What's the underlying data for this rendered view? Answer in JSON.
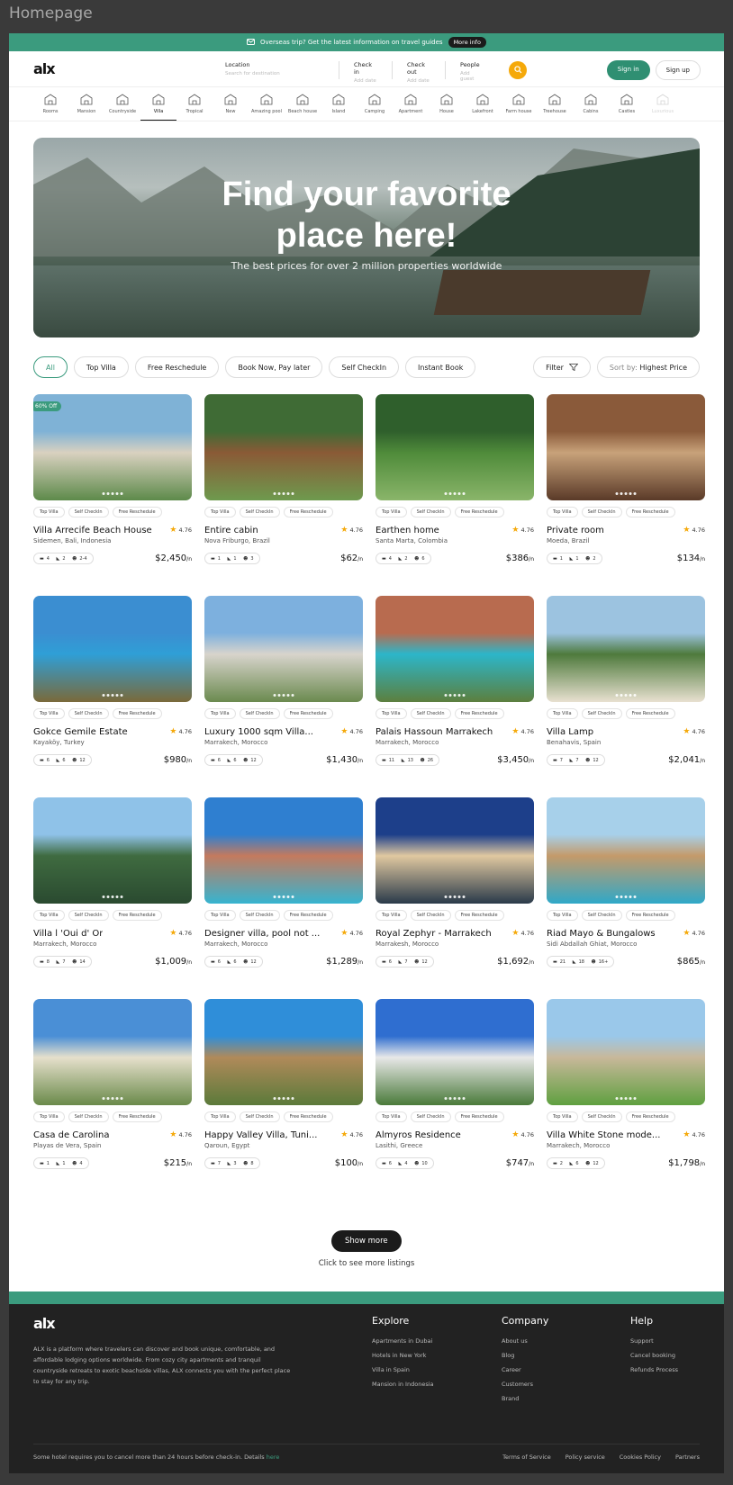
{
  "frame_title": "Homepage",
  "promo": {
    "text": "Overseas trip? Get the latest information on travel guides",
    "button": "More info"
  },
  "brand": "alx",
  "search": {
    "location": {
      "label": "Location",
      "placeholder": "Search for destination"
    },
    "checkin": {
      "label": "Check in",
      "placeholder": "Add date"
    },
    "checkout": {
      "label": "Check out",
      "placeholder": "Add date"
    },
    "people": {
      "label": "People",
      "placeholder": "Add guest"
    }
  },
  "auth": {
    "signin": "Sign in",
    "signup": "Sign up"
  },
  "categories": [
    "Rooms",
    "Mansion",
    "Countryside",
    "Villa",
    "Tropical",
    "New",
    "Amazing pool",
    "Beach house",
    "Island",
    "Camping",
    "Apartment",
    "House",
    "Lakefront",
    "Farm house",
    "Treehouse",
    "Cabins",
    "Castles",
    "Luxurious"
  ],
  "active_category": "Villa",
  "hero": {
    "title_line1": "Find your favorite",
    "title_line2": "place here!",
    "subtitle": "The best prices for over 2 million properties worldwide"
  },
  "filters": [
    "All",
    "Top Villa",
    "Free Reschedule",
    "Book Now, Pay later",
    "Self CheckIn",
    "Instant Book"
  ],
  "filter_button": "Filter",
  "sort": {
    "label": "Sort by:",
    "value": "Highest Price"
  },
  "tag_labels": [
    "Top Villa",
    "Self CheckIn",
    "Free Reschedule"
  ],
  "listings": [
    {
      "name": "Villa Arrecife Beach House",
      "location": "Sidemen, Bali, Indonesia",
      "rating": "4.76",
      "beds": "4",
      "baths": "2",
      "guests": "2-4",
      "price": "$2,450",
      "badge": "60% Off"
    },
    {
      "name": "Entire cabin",
      "location": "Nova Friburgo, Brazil",
      "rating": "4.76",
      "beds": "1",
      "baths": "1",
      "guests": "3",
      "price": "$62",
      "badge": ""
    },
    {
      "name": "Earthen home",
      "location": "Santa Marta, Colombia",
      "rating": "4.76",
      "beds": "4",
      "baths": "2",
      "guests": "6",
      "price": "$386",
      "badge": ""
    },
    {
      "name": "Private room",
      "location": "Moeda, Brazil",
      "rating": "4.76",
      "beds": "1",
      "baths": "1",
      "guests": "2",
      "price": "$134",
      "badge": ""
    },
    {
      "name": "Gokce Gemile Estate",
      "location": "Kayaköy, Turkey",
      "rating": "4.76",
      "beds": "6",
      "baths": "6",
      "guests": "12",
      "price": "$980",
      "badge": ""
    },
    {
      "name": "Luxury 1000 sqm Villa...",
      "location": "Marrakech, Morocco",
      "rating": "4.76",
      "beds": "6",
      "baths": "6",
      "guests": "12",
      "price": "$1,430",
      "badge": ""
    },
    {
      "name": "Palais Hassoun Marrakech",
      "location": "Marrakech, Morocco",
      "rating": "4.76",
      "beds": "11",
      "baths": "13",
      "guests": "26",
      "price": "$3,450",
      "badge": ""
    },
    {
      "name": "Villa Lamp",
      "location": "Benahavis, Spain",
      "rating": "4.76",
      "beds": "7",
      "baths": "7",
      "guests": "12",
      "price": "$2,041",
      "badge": ""
    },
    {
      "name": "Villa l 'Oui d' Or",
      "location": "Marrakech, Morocco",
      "rating": "4.76",
      "beds": "8",
      "baths": "7",
      "guests": "14",
      "price": "$1,009",
      "badge": ""
    },
    {
      "name": "Designer villa, pool not ...",
      "location": "Marrakech, Morocco",
      "rating": "4.76",
      "beds": "6",
      "baths": "6",
      "guests": "12",
      "price": "$1,289",
      "badge": ""
    },
    {
      "name": "Royal Zephyr - Marrakech",
      "location": "Marrakesh, Morocco",
      "rating": "4.76",
      "beds": "6",
      "baths": "7",
      "guests": "12",
      "price": "$1,692",
      "badge": ""
    },
    {
      "name": "Riad Mayo & Bungalows",
      "location": "Sidi Abdallah Ghiat, Morocco",
      "rating": "4.76",
      "beds": "21",
      "baths": "18",
      "guests": "16+",
      "price": "$865",
      "badge": ""
    },
    {
      "name": "Casa de Carolina",
      "location": "Playas de Vera, Spain",
      "rating": "4.76",
      "beds": "1",
      "baths": "1",
      "guests": "4",
      "price": "$215",
      "badge": ""
    },
    {
      "name": "Happy Valley Villa, Tuni...",
      "location": "Qaroun, Egypt",
      "rating": "4.76",
      "beds": "7",
      "baths": "3",
      "guests": "8",
      "price": "$100",
      "badge": ""
    },
    {
      "name": "Almyros Residence",
      "location": "Lasithi, Greece",
      "rating": "4.76",
      "beds": "6",
      "baths": "4",
      "guests": "10",
      "price": "$747",
      "badge": ""
    },
    {
      "name": "Villa White Stone mode...",
      "location": "Marrakech, Morocco",
      "rating": "4.76",
      "beds": "2",
      "baths": "6",
      "guests": "12",
      "price": "$1,798",
      "badge": ""
    }
  ],
  "price_unit": "/n",
  "show_more": {
    "button": "Show more",
    "caption": "Click to see more listings"
  },
  "footer": {
    "brand": "alx",
    "description": "ALX is a platform where travelers can discover and book unique, comfortable, and affordable lodging options worldwide. From cozy city apartments and tranquil countryside retreats to exotic beachside villas, ALX connects you with the perfect place to stay for any trip.",
    "explore": {
      "title": "Explore",
      "links": [
        "Apartments in Dubai",
        "Hotels in New York",
        "Villa in Spain",
        "Mansion in Indonesia"
      ]
    },
    "company": {
      "title": "Company",
      "links": [
        "About us",
        "Blog",
        "Career",
        "Customers",
        "Brand"
      ]
    },
    "help": {
      "title": "Help",
      "links": [
        "Support",
        "Cancel booking",
        "Refunds Process"
      ]
    },
    "notice": "Some hotel requires you to cancel more than 24 hours before check-in. Details",
    "notice_link": "here",
    "legal": [
      "Terms of Service",
      "Policy service",
      "Cookies Policy",
      "Partners"
    ]
  },
  "colors": {
    "accent": "#3b9b7e",
    "star": "#f5a90a",
    "dark": "#1b1b1b"
  }
}
